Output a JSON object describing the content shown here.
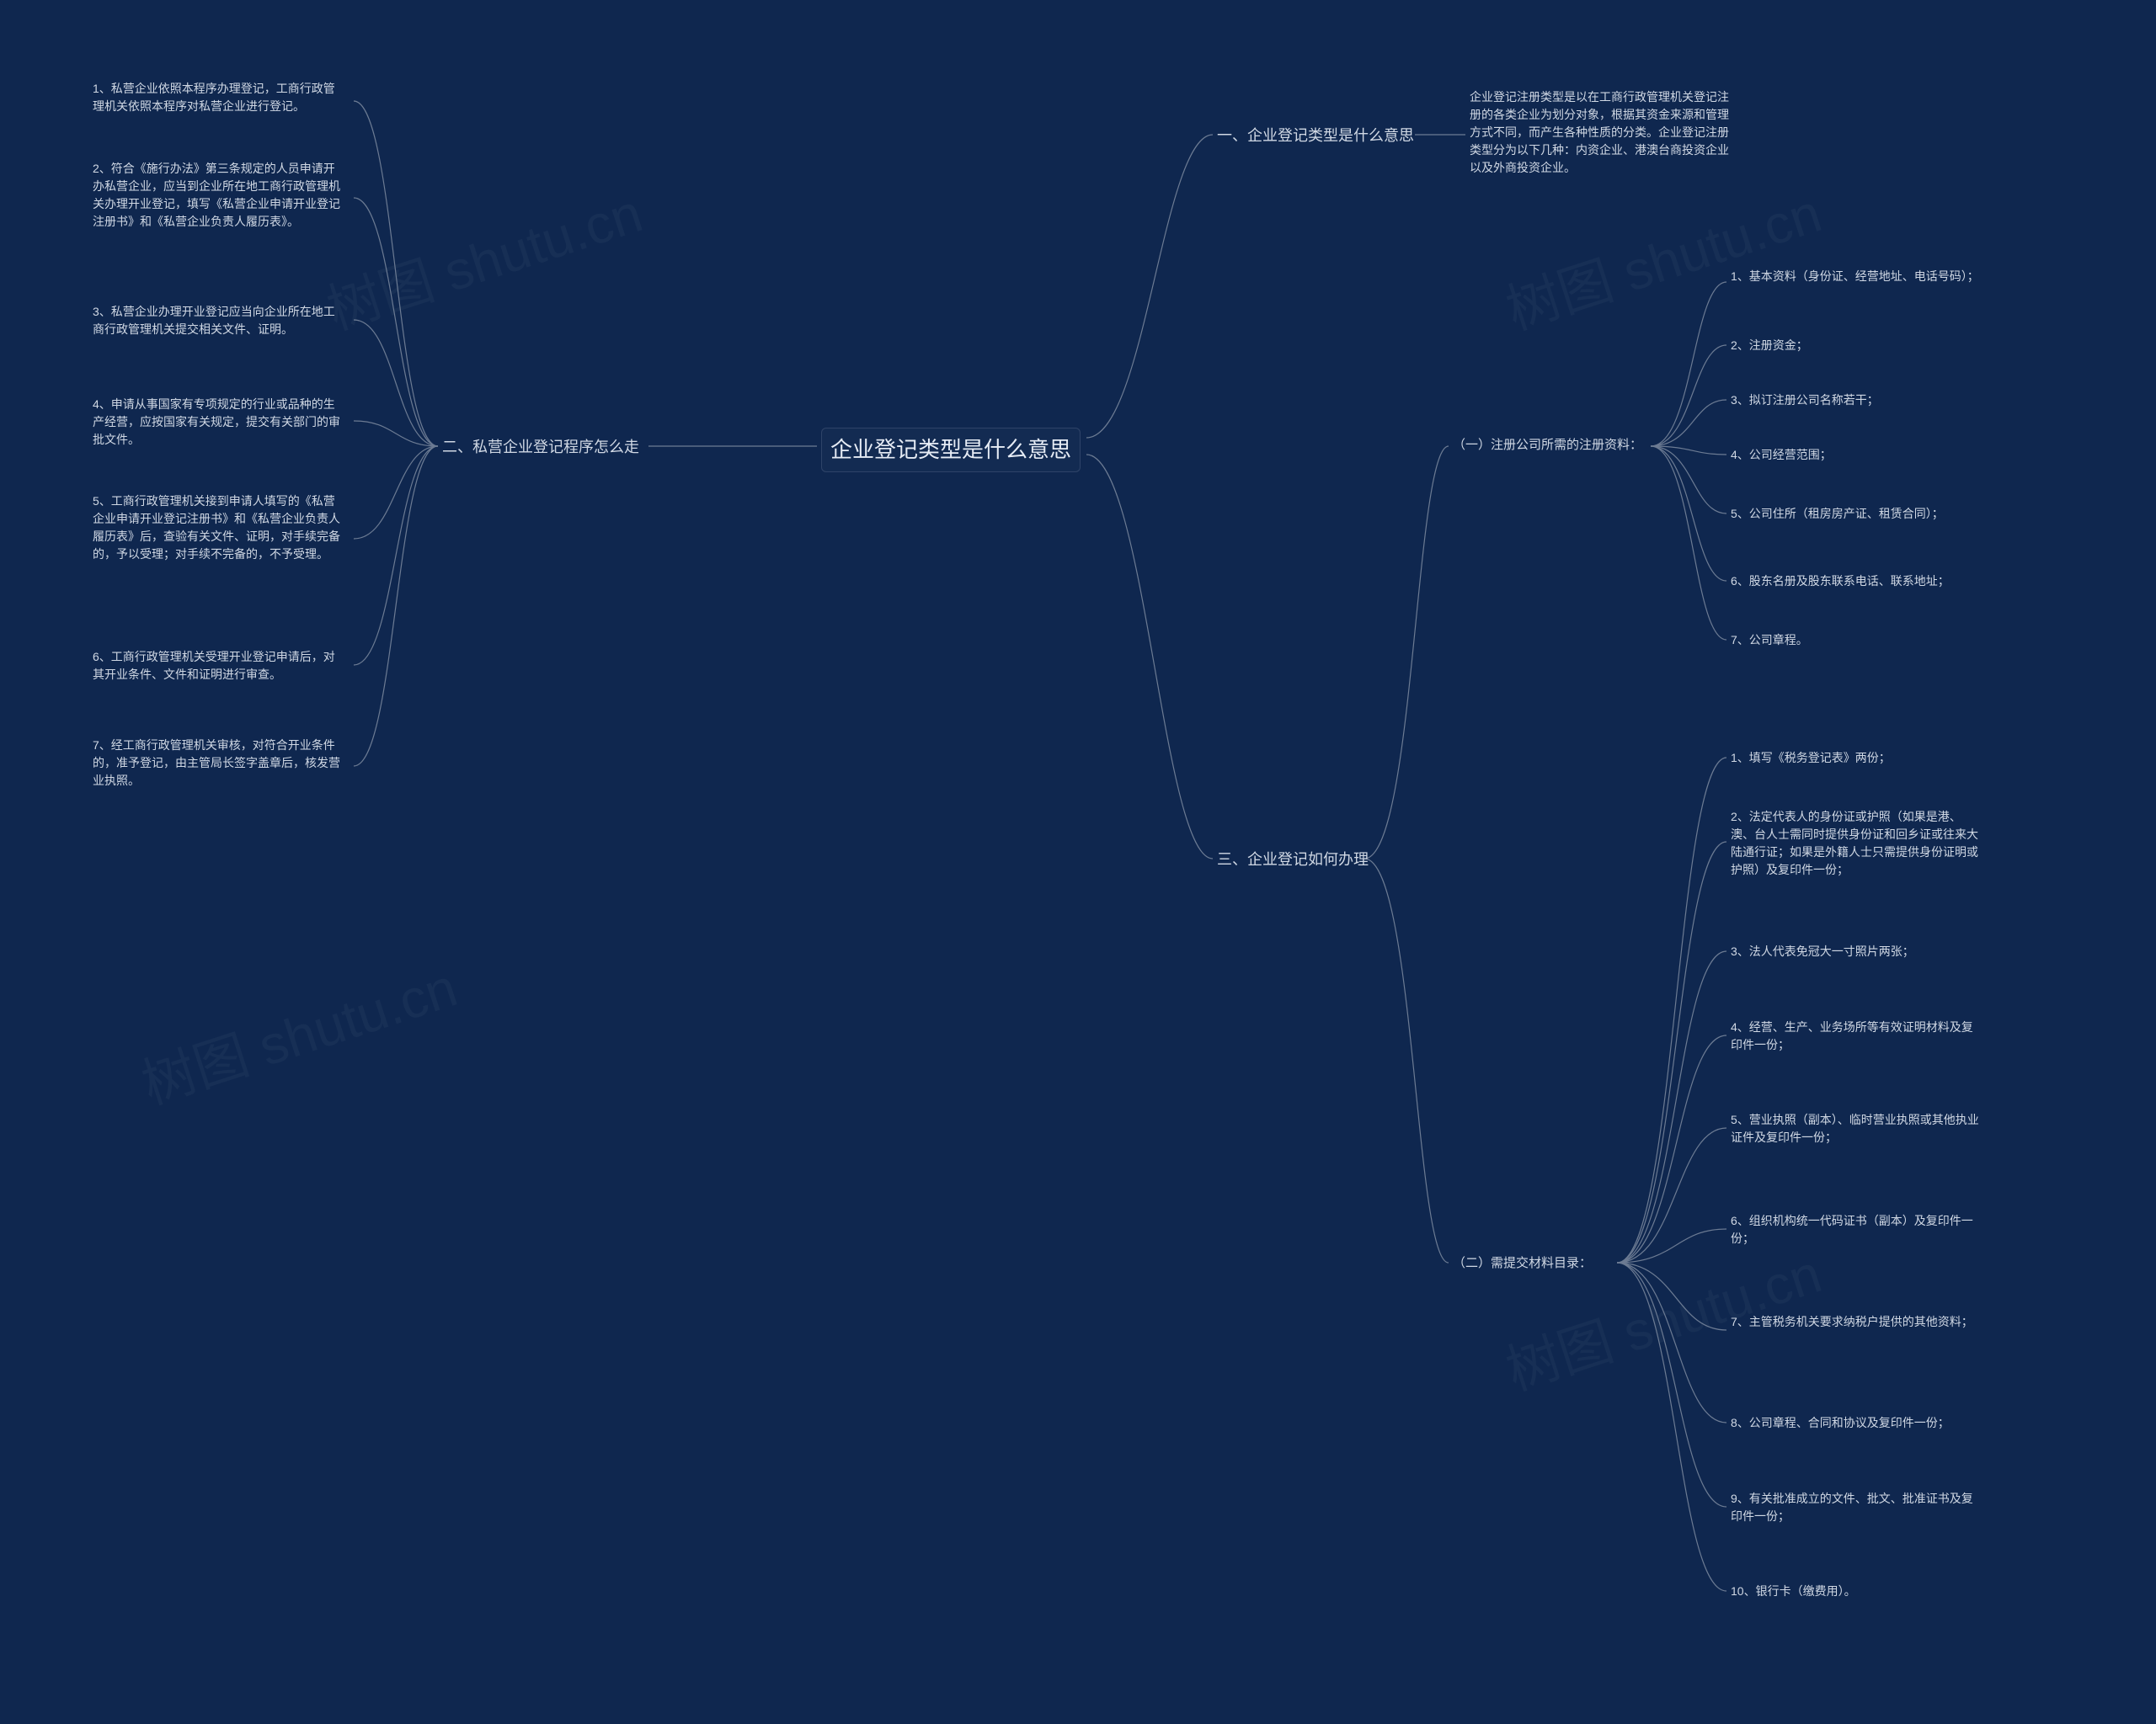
{
  "colors": {
    "bg": "#0f274f",
    "text": "#c9d3e0",
    "line": "#6c7b93"
  },
  "watermark": "树图 shutu.cn",
  "center": "企业登记类型是什么意思",
  "branch_left": {
    "title": "二、私营企业登记程序怎么走",
    "items": [
      "1、私营企业依照本程序办理登记，工商行政管理机关依照本程序对私营企业进行登记。",
      "2、符合《施行办法》第三条规定的人员申请开办私营企业，应当到企业所在地工商行政管理机关办理开业登记，填写《私营企业申请开业登记注册书》和《私营企业负责人履历表》。",
      "3、私营企业办理开业登记应当向企业所在地工商行政管理机关提交相关文件、证明。",
      "4、申请从事国家有专项规定的行业或品种的生产经营，应按国家有关规定，提交有关部门的审批文件。",
      "5、工商行政管理机关接到申请人填写的《私营企业申请开业登记注册书》和《私营企业负责人履历表》后，查验有关文件、证明，对手续完备的，予以受理；对手续不完备的，不予受理。",
      "6、工商行政管理机关受理开业登记申请后，对其开业条件、文件和证明进行审查。",
      "7、经工商行政管理机关审核，对符合开业条件的，准予登记，由主管局长签字盖章后，核发营业执照。"
    ]
  },
  "branch_right_1": {
    "title": "一、企业登记类型是什么意思",
    "desc": "企业登记注册类型是以在工商行政管理机关登记注册的各类企业为划分对象，根据其资金来源和管理方式不同，而产生各种性质的分类。企业登记注册类型分为以下几种：内资企业、港澳台商投资企业以及外商投资企业。"
  },
  "branch_right_2": {
    "title": "三、企业登记如何办理",
    "sub_a": {
      "title": "（一）注册公司所需的注册资料：",
      "items": [
        "1、基本资料（身份证、经营地址、电话号码）；",
        "2、注册资金；",
        "3、拟订注册公司名称若干；",
        "4、公司经营范围；",
        "5、公司住所（租房房产证、租赁合同）；",
        "6、股东名册及股东联系电话、联系地址；",
        "7、公司章程。"
      ]
    },
    "sub_b": {
      "title": "（二）需提交材料目录：",
      "items": [
        "1、填写《税务登记表》两份；",
        "2、法定代表人的身份证或护照（如果是港、澳、台人士需同时提供身份证和回乡证或往来大陆通行证；如果是外籍人士只需提供身份证明或护照）及复印件一份；",
        "3、法人代表免冠大一寸照片两张；",
        "4、经营、生产、业务场所等有效证明材料及复印件一份；",
        "5、营业执照（副本）、临时营业执照或其他执业证件及复印件一份；",
        "6、组织机构统一代码证书（副本）及复印件一份；",
        "7、主管税务机关要求纳税户提供的其他资料；",
        "8、公司章程、合同和协议及复印件一份；",
        "9、有关批准成立的文件、批文、批准证书及复印件一份；",
        "10、银行卡（缴费用）。"
      ]
    }
  }
}
